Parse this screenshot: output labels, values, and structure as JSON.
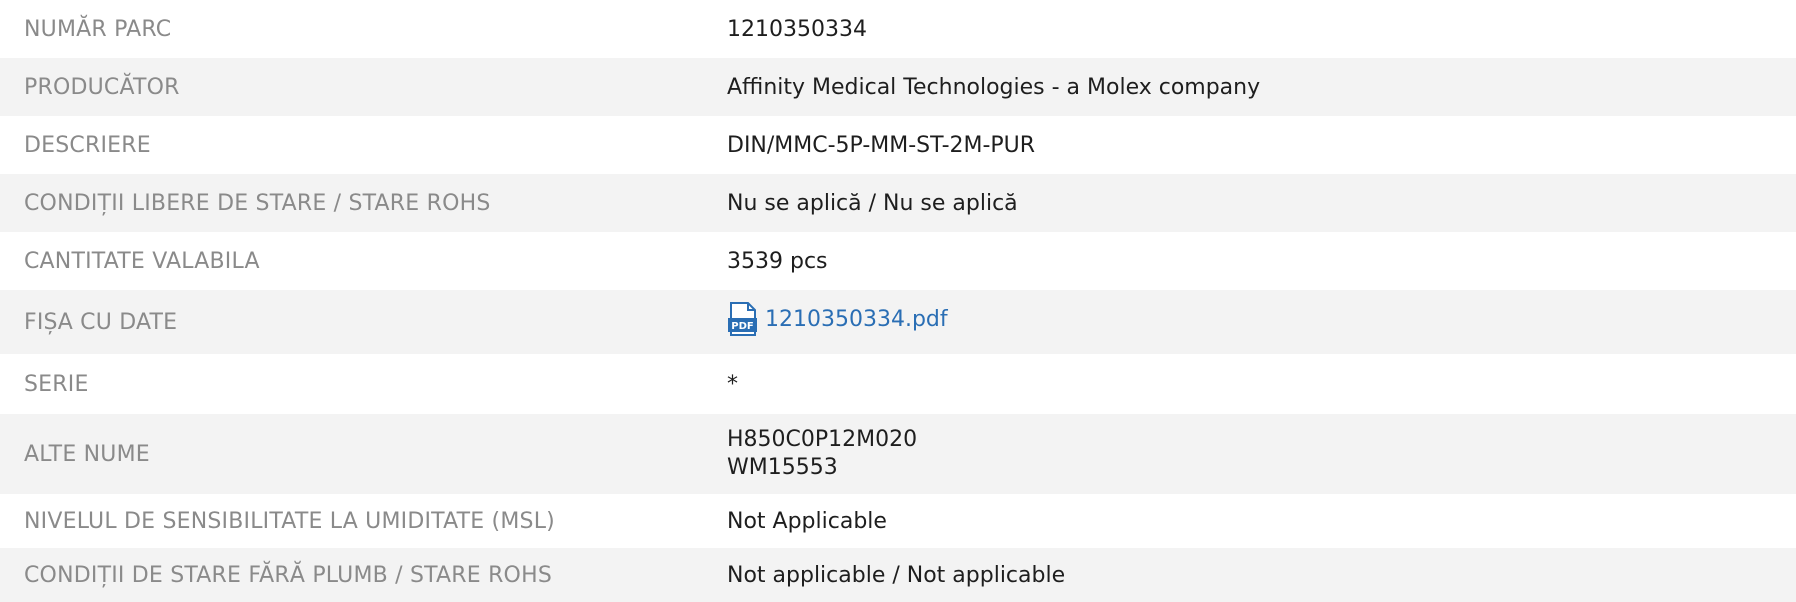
{
  "rows": [
    {
      "label": "NUMĂR PARC",
      "value": "1210350334"
    },
    {
      "label": "PRODUCĂTOR",
      "value": "Affinity Medical Technologies - a Molex company"
    },
    {
      "label": "DESCRIERE",
      "value": "DIN/MMC-5P-MM-ST-2M-PUR"
    },
    {
      "label": "CONDIȚII LIBERE DE STARE / STARE ROHS",
      "value": "Nu se aplică / Nu se aplică"
    },
    {
      "label": "CANTITATE VALABILA",
      "value": "3539 pcs"
    },
    {
      "label": "FIȘA CU DATE",
      "value": "1210350334.pdf",
      "icon": "pdf-icon"
    },
    {
      "label": "SERIE",
      "value": "*"
    },
    {
      "label": "ALTE NUME",
      "values": [
        "H850C0P12M020",
        "WM15553"
      ]
    },
    {
      "label": "NIVELUL DE SENSIBILITATE LA UMIDITATE (MSL)",
      "value": "Not Applicable"
    },
    {
      "label": "CONDIȚII DE STARE FĂRĂ PLUMB / STARE ROHS",
      "value": "Not applicable / Not applicable"
    }
  ],
  "colors": {
    "label": "#8a8a8a",
    "value": "#1e1e1e",
    "link": "#2a6eb4",
    "row_alt_bg": "#f3f3f3"
  }
}
